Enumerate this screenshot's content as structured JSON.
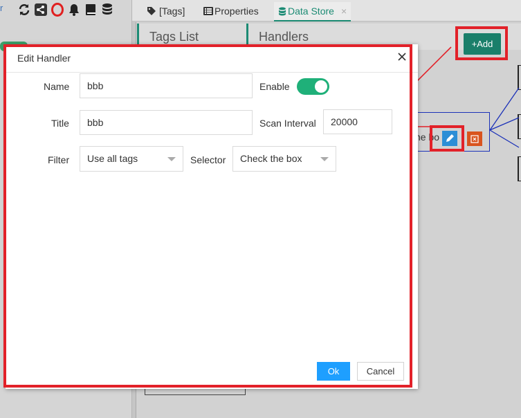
{
  "toolbar": {
    "fragment": "r"
  },
  "tabs": [
    {
      "label": "[Tags]",
      "icon": "tags-icon"
    },
    {
      "label": "Properties",
      "icon": "list-icon"
    },
    {
      "label": "Data Store",
      "icon": "database-icon",
      "active": true,
      "close": "×"
    }
  ],
  "panels": {
    "tags_list": "Tags List",
    "handlers": "Handlers"
  },
  "add_button": "+Add",
  "handler_card": {
    "text": "he bo"
  },
  "dialog": {
    "title": "Edit Handler",
    "close": "×",
    "fields": {
      "name": {
        "label": "Name",
        "value": "bbb"
      },
      "enable": {
        "label": "Enable",
        "on": true
      },
      "title": {
        "label": "Title",
        "value": "bbb"
      },
      "scan_interval": {
        "label": "Scan Interval",
        "value": "20000"
      },
      "filter": {
        "label": "Filter",
        "value": "Use all tags"
      },
      "selector": {
        "label": "Selector",
        "value": "Check the box"
      }
    },
    "ok_label": "Ok",
    "cancel_label": "Cancel"
  },
  "colors": {
    "accent": "#1c8b74",
    "annotation_red": "#e22129",
    "ok_blue": "#1e9fff",
    "toggle_green": "#1fb079",
    "edit_blue": "#2c8ed6",
    "delete_orange": "#d9541e"
  }
}
